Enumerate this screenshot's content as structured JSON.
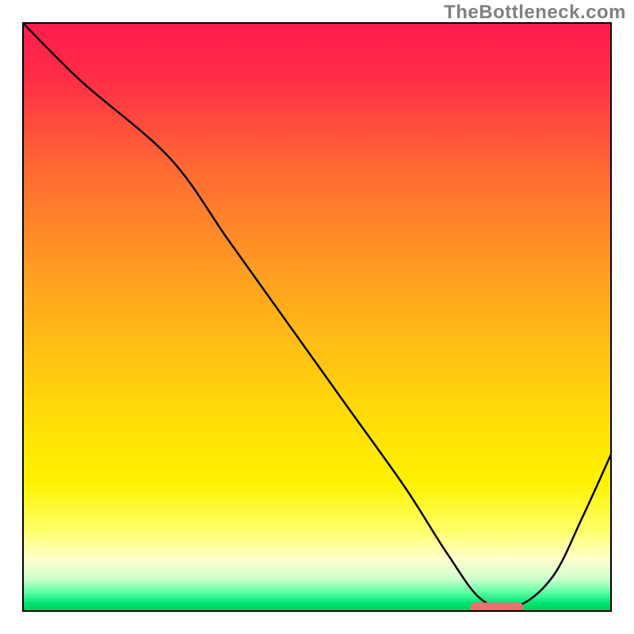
{
  "watermark": "TheBottleneck.com",
  "chart_data": {
    "type": "line",
    "title": "",
    "xlabel": "",
    "ylabel": "",
    "xlim": [
      0,
      100
    ],
    "ylim": [
      0,
      100
    ],
    "grid": false,
    "legend": false,
    "series": [
      {
        "name": "bottleneck-curve",
        "color": "#000000",
        "x": [
          0,
          10,
          25,
          35,
          45,
          55,
          65,
          72,
          78,
          84,
          90,
          95,
          100
        ],
        "y": [
          100,
          90,
          77,
          63,
          49,
          35,
          21,
          10,
          2,
          1,
          6,
          16,
          27
        ]
      }
    ],
    "markers": [
      {
        "name": "optimal-zone",
        "shape": "rounded-bar",
        "color": "#e5736f",
        "x_range": [
          76,
          85
        ],
        "y": 0.7
      }
    ],
    "background_gradient": {
      "stops": [
        {
          "offset": 0.0,
          "color": "#ff1a4d"
        },
        {
          "offset": 0.1,
          "color": "#ff2f47"
        },
        {
          "offset": 0.25,
          "color": "#ff6a33"
        },
        {
          "offset": 0.45,
          "color": "#ffa51f"
        },
        {
          "offset": 0.65,
          "color": "#ffd80a"
        },
        {
          "offset": 0.78,
          "color": "#fff200"
        },
        {
          "offset": 0.86,
          "color": "#ffff66"
        },
        {
          "offset": 0.91,
          "color": "#ffffcc"
        },
        {
          "offset": 0.945,
          "color": "#ccffcc"
        },
        {
          "offset": 0.965,
          "color": "#66ffaa"
        },
        {
          "offset": 0.985,
          "color": "#00e676"
        },
        {
          "offset": 1.0,
          "color": "#00c853"
        }
      ]
    }
  }
}
